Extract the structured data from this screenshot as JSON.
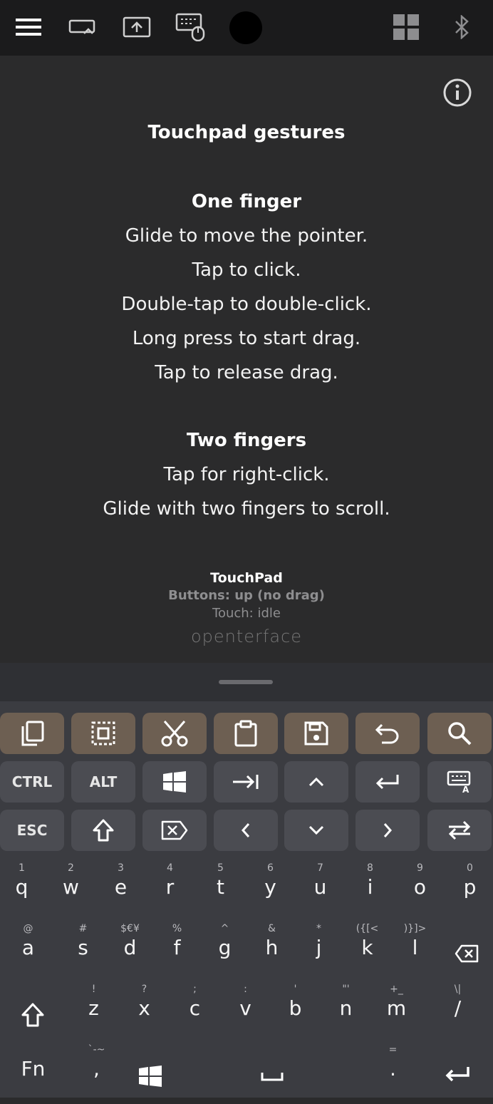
{
  "toolbar": {
    "icons": [
      "menu-icon",
      "keyboard-swap-icon",
      "upload-icon",
      "keyboard-mouse-icon",
      "grid-icon",
      "bluetooth-icon"
    ]
  },
  "gestures": {
    "heading": "Touchpad gestures",
    "one_finger_title": "One finger",
    "one_finger_lines": [
      "Glide to move the pointer.",
      "Tap to click.",
      "Double-tap to double-click.",
      "Long press to start drag.",
      "Tap to release drag."
    ],
    "two_fingers_title": "Two fingers",
    "two_fingers_lines": [
      "Tap for right-click.",
      "Glide with two fingers to scroll."
    ]
  },
  "status": {
    "title": "TouchPad",
    "buttons": "Buttons: up (no drag)",
    "touch": "Touch: idle",
    "brand": "openterface"
  },
  "keyboard": {
    "row1_icons": [
      "copy-icon",
      "select-all-icon",
      "cut-icon",
      "paste-icon",
      "save-icon",
      "undo-icon",
      "search-icon"
    ],
    "row2": {
      "ctrl": "CTRL",
      "alt": "ALT"
    },
    "row3": {
      "esc": "ESC"
    },
    "letters_row1": [
      [
        "1",
        "q"
      ],
      [
        "2",
        "w"
      ],
      [
        "3",
        "e"
      ],
      [
        "4",
        "r"
      ],
      [
        "5",
        "t"
      ],
      [
        "6",
        "y"
      ],
      [
        "7",
        "u"
      ],
      [
        "8",
        "i"
      ],
      [
        "9",
        "o"
      ],
      [
        "0",
        "p"
      ]
    ],
    "letters_row2": [
      [
        "@",
        "a"
      ],
      [
        "#",
        "s"
      ],
      [
        "$€¥",
        "d"
      ],
      [
        "%",
        "f"
      ],
      [
        "^",
        "g"
      ],
      [
        "&",
        "h"
      ],
      [
        "*",
        "j"
      ],
      [
        "({[<",
        "k"
      ],
      [
        ")}]>",
        "l"
      ]
    ],
    "letters_row3": [
      [
        "!",
        "z"
      ],
      [
        "?",
        "x"
      ],
      [
        ";",
        "c"
      ],
      [
        ":",
        "v"
      ],
      [
        "'",
        "b"
      ],
      [
        "\"'",
        "n"
      ],
      [
        "+_",
        "m"
      ],
      [
        "\\|",
        "/"
      ]
    ],
    "bottom": {
      "fn": "Fn",
      "comma_hint": "`-~",
      "comma": ",",
      "period_hint": "=",
      "period": "."
    }
  }
}
